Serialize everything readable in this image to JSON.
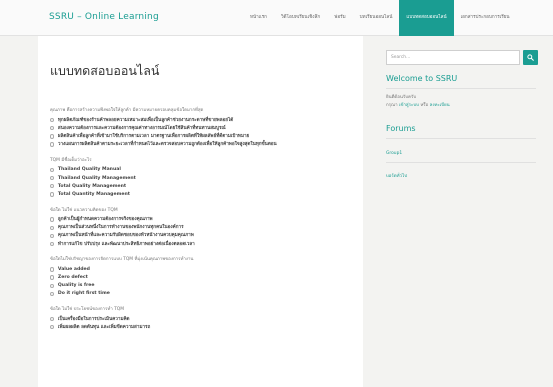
{
  "header": {
    "brand": "SSRU – Online Learning",
    "nav": [
      {
        "label": "หน้าแรก",
        "active": false
      },
      {
        "label": "วิดีโอบทเรียนเชิงลึก",
        "active": false
      },
      {
        "label": "ฟอรัม",
        "active": false
      },
      {
        "label": "บทเรียนออนไลน์",
        "active": false
      },
      {
        "label": "แบบทดสอบออนไลน์",
        "active": true
      },
      {
        "label": "เอกสารประกอบการเรียน",
        "active": false
      }
    ]
  },
  "main": {
    "title": "แบบทดสอบออนไลน์",
    "questions": [
      {
        "text": "คุณภาพ คือการสร้างความพึงพอใจให้ลูกค้า มีความหมายครอบคลุมข้อใดมากที่สุด",
        "options": [
          "ทุกผลิตภัณฑ์ของร้านค้าพลอยความเหมาะสมเพื่อเป็นลูกค้าช่วยงานกระดาษที่ขายพลอยได้",
          "สนองความต้องการและความต้องการคุณค่าทางอารมณ์โดยใช้สินค้าที่ทนทานสมบูรณ์",
          "ผลิตสินค้าเพื่อลูกค้าที่เข้ามาใช้บริการตามเวลา มาตรฐานเพื่อการผลิตที่ให้ผลลัพธ์ที่ดีตามเป้าหมาย",
          "วางแผนการผลิตสินค้าตามระยะเวลาที่กำหนดไว้และตรวจสอบความถูกต้องเพื่อให้ลูกค้าพอใจสูงสุดในทุกขั้นตอน"
        ]
      },
      {
        "text": "TQM มีชื่อเต็มว่าอะไร",
        "options": [
          "Thailand Quality Manual",
          "Thailand Quality Management",
          "Total Quality Management",
          "Total Quantity Management"
        ]
      },
      {
        "text": "ข้อใด ไม่ใช่ แนวความคิดของ TQM",
        "options": [
          "ลูกค้าเป็นผู้กำหนดความต้องการจริงของคุณภาพ",
          "คุณภาพเป็นส่วนหนึ่งในการทำงานของพนักงานทุกคนในองค์การ",
          "คุณภาพเป็นหน้าที่และความรับผิดชอบของหัวหน้างานควบคุมคุณภาพ",
          "ทำการแก้ไข ปรับปรุง และพัฒนาประสิทธิภาพอย่างต่อเนื่องตลอดเวลา"
        ]
      },
      {
        "text": "ข้อใดไม่ใช่ปรัชญาของการจัดการแบบ TQM ที่มุ่งเน้นคุณภาพของการทำงาน",
        "options": [
          "Value added",
          "Zero defect",
          "Quality is free",
          "Do it right first time"
        ]
      },
      {
        "text": "ข้อใด ไม่ใช่ ประโยชน์ของการทำ TQM",
        "options": [
          "เป็นเครื่องมือในการประเมินความคิด",
          "เพิ่มผลผลิต ลดต้นทุน และเพิ่มขีดความสามารถ"
        ]
      }
    ]
  },
  "sidebar": {
    "search_placeholder": "Search...",
    "welcome_title": "Welcome to SSRU",
    "welcome_line1": "ยินดีต้อนรับครับ",
    "welcome_line2_prefix": "กรุณา",
    "login_link": "เข้าสู่ระบบ",
    "or_text": "หรือ",
    "register_link": "ลงทะเบียน",
    "forums_title": "Forums",
    "forum_links": [
      "Group1",
      "บอร์ดทั่วไป"
    ]
  },
  "colors": {
    "accent": "#1a9d92",
    "background": "#f3f3f1",
    "panel": "#ffffff"
  },
  "icons": {
    "search": "search-icon"
  }
}
